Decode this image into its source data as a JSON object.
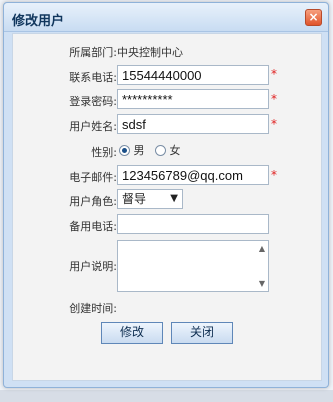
{
  "dialog": {
    "title": "修改用户",
    "close_glyph": "×"
  },
  "form": {
    "org_label": "所属部门:",
    "org_value": "中央控制中心",
    "phone_label": "联系电话:",
    "phone_value": "15544440000",
    "password_label": "登录密码:",
    "password_value": "**********",
    "username_label": "用户姓名:",
    "username_value": "sdsf",
    "gender_label": "性别:",
    "gender_options": [
      "男",
      "女"
    ],
    "gender_selected": "男",
    "email_label": "电子邮件:",
    "email_value": "123456789@qq.com",
    "role_label": "用户角色:",
    "role_value": "督导",
    "contact_label": "备用电话:",
    "contact_value": "",
    "remark_label": "用户说明:",
    "remark_value": "",
    "created_label": "创建时间:",
    "required_mark": "*"
  },
  "buttons": {
    "save_label": "修改",
    "close_label": "关闭"
  },
  "colors": {
    "title_bar": "#c8dcf2",
    "required": "#e02020",
    "close_button": "#e0552c"
  }
}
